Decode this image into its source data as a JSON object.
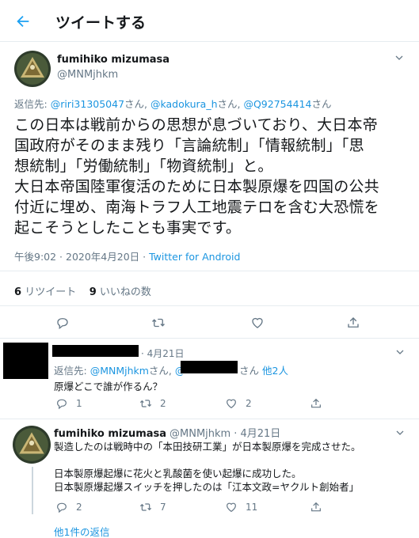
{
  "header": {
    "title": "ツイートする"
  },
  "main_tweet": {
    "name": "fumihiko mizumasa",
    "handle": "@MNMjhkm",
    "reply_to_prefix": "返信先: ",
    "reply_to_1": "@riri31305047",
    "reply_to_sep1": "さん, ",
    "reply_to_2": "@kadokura_h",
    "reply_to_sep2": "さん, ",
    "reply_to_3": "@Q92754414",
    "reply_to_suffix": "さん",
    "body_lines": [
      "この日本は戦前からの思想が息づいており、大日本帝",
      "国政府がそのまま残り「言論統制」「情報統制」「思",
      "想統制」「労働統制」「物資統制」と。",
      "大日本帝国陸軍復活のために日本製原爆を四国の公共",
      "付近に埋め、南海トラフ人工地震テロを含む大恐慌を",
      "起こそうとしたことも事実です。"
    ],
    "timestamp": "午後9:02 · 2020年4月20日 · ",
    "source": "Twitter for Android",
    "retweet_count": "6",
    "retweet_label": "リツイート",
    "like_count": "9",
    "like_label": "いいねの数"
  },
  "reply_1": {
    "date": "· 4月21日",
    "reply_to_prefix": "返信先: ",
    "reply_to_1": "@MNMjhkm",
    "reply_to_sep": "さん, ",
    "reply_to_2": "@",
    "reply_to_suffix": "さん",
    "others": "他2人",
    "text": "原爆どこで誰が作るん？",
    "reply_count": "1",
    "retweet_count": "2",
    "like_count": "2"
  },
  "reply_2": {
    "name": "fumihiko mizumasa",
    "handle": "@MNMjhkm",
    "date": "· 4月21日",
    "lines": [
      "製造したのは戦時中の「本田技研工業」が日本製原爆を完成させた。",
      "",
      "日本製原爆起爆に花火と乳酸菌を使い起爆に成功した。",
      "日本製原爆起爆スイッチを押したのは「江本文政=ヤクルト創始者」"
    ],
    "reply_count": "2",
    "retweet_count": "7",
    "like_count": "11",
    "more_replies": "他1件の返信"
  },
  "colors": {
    "link": "#1b95e0",
    "muted": "#657786",
    "divider": "#e6ecf0"
  },
  "icons": [
    "back-arrow-icon",
    "chevron-down-icon",
    "reply-icon",
    "retweet-icon",
    "like-icon",
    "share-icon"
  ]
}
